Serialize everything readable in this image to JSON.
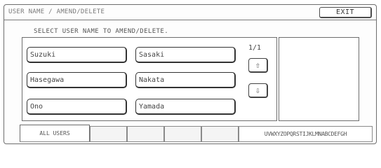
{
  "window": {
    "title": "USER NAME / AMEND/DELETE",
    "exit_label": "EXIT"
  },
  "instruction": "SELECT USER NAME TO AMEND/DELETE.",
  "users": [
    "Suzuki",
    "Sasaki",
    "Hasegawa",
    "Nakata",
    "Ono",
    "Yamada"
  ],
  "pagination": {
    "counter": "1/1",
    "up_icon": "arrow-up-icon",
    "down_icon": "arrow-down-icon"
  },
  "tabs": [
    "ALL USERS",
    "",
    "",
    "",
    "",
    "UVWXYZOPQRSTIJKLMNABCDEFGH"
  ]
}
